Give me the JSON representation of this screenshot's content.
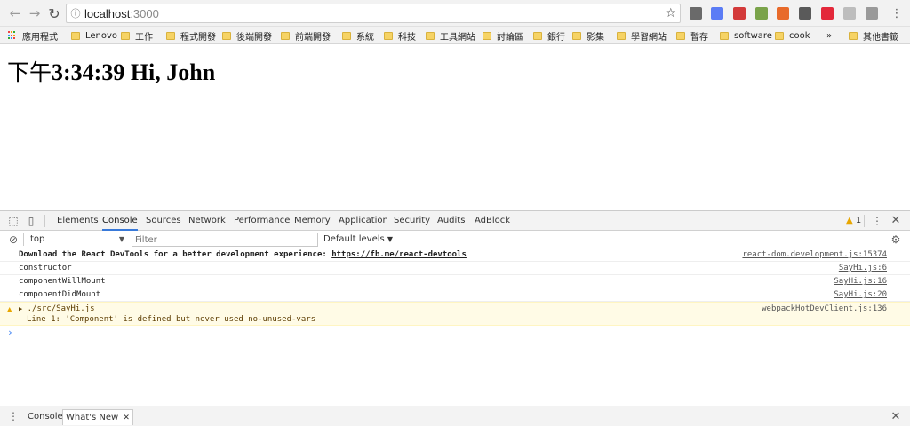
{
  "browser": {
    "url_host": "localhost",
    "url_port": ":3000",
    "extensions": [
      {
        "name": "shield-extension-icon",
        "color": "#6a6a6a"
      },
      {
        "name": "react-devtools-extension-icon",
        "color": "#5b7cf5"
      },
      {
        "name": "bookmark-extension-icon",
        "color": "#d33a3a"
      },
      {
        "name": "evernote-extension-icon",
        "color": "#7aa34a"
      },
      {
        "name": "block-extension-icon",
        "color": "#e86a2a"
      },
      {
        "name": "save-extension-icon",
        "color": "#5a5a5a"
      },
      {
        "name": "opera-extension-icon",
        "color": "#e3283a"
      },
      {
        "name": "screen-extension-icon",
        "color": "#bdbdbd"
      },
      {
        "name": "skype-extension-icon",
        "color": "#9a9a9a"
      }
    ]
  },
  "bookmarks": {
    "apps_label": "應用程式",
    "items": [
      "Lenovo",
      "工作",
      "程式開發",
      "後端開發",
      "前端開發",
      "系統",
      "科技",
      "工具網站",
      "討論區",
      "銀行",
      "影集",
      "學習網站",
      "暫存",
      "software",
      "cook"
    ],
    "overflow": "»",
    "other": "其他書籤"
  },
  "page": {
    "time_prefix": "下午",
    "time_and_greeting": "3:34:39 Hi, John"
  },
  "devtools": {
    "tabs": [
      "Elements",
      "Console",
      "Sources",
      "Network",
      "Performance",
      "Memory",
      "Application",
      "Security",
      "Audits",
      "AdBlock"
    ],
    "active_tab": "Console",
    "warning_count": "1",
    "context": "top",
    "filter_placeholder": "Filter",
    "levels": "Default levels",
    "messages": [
      {
        "text": "Download the React DevTools for a better development experience: ",
        "link": "https://fb.me/react-devtools",
        "source": "react-dom.development.js:15374"
      },
      {
        "text": "constructor",
        "source": "SayHi.js:6"
      },
      {
        "text": "componentWillMount",
        "source": "SayHi.js:16"
      },
      {
        "text": "componentDidMount",
        "source": "SayHi.js:20"
      }
    ],
    "warning": {
      "title": "./src/SayHi.js",
      "detail": "Line 1:  'Component' is defined but never used  no-unused-vars",
      "source": "webpackHotDevClient.js:136"
    },
    "drawer": {
      "tabs": [
        "Console",
        "What's New"
      ],
      "active": "What's New"
    }
  }
}
